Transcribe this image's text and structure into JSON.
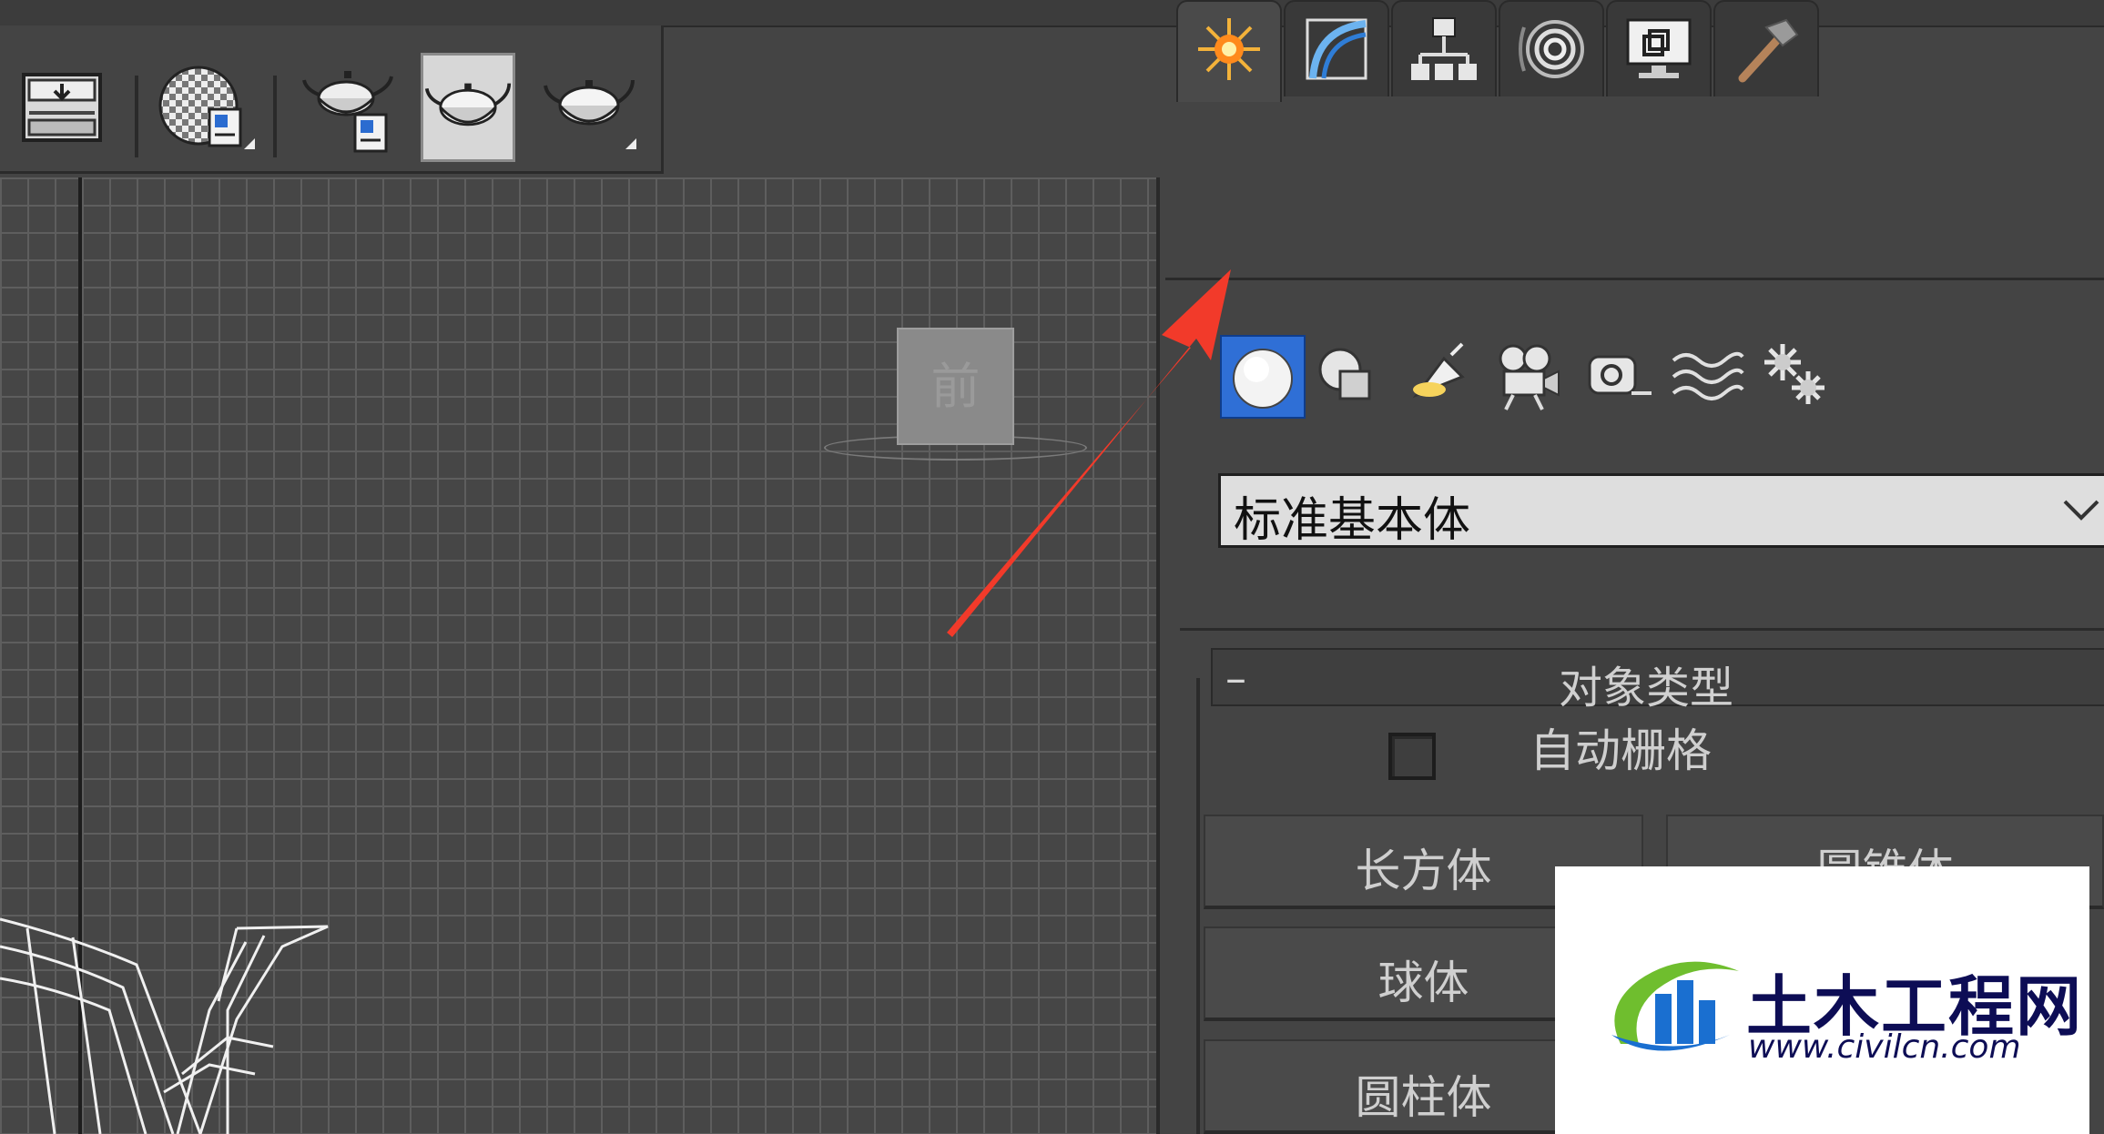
{
  "toolbar": {
    "buttons": [
      {
        "icon": "render-setup-icon"
      },
      {
        "icon": "material-editor-icon"
      },
      {
        "icon": "render-frame-window-icon"
      },
      {
        "icon": "render-production-icon"
      },
      {
        "icon": "render-iterative-icon"
      }
    ]
  },
  "viewport": {
    "viewcube_label": "前"
  },
  "command_panel": {
    "tabs": [
      {
        "icon": "create-tab-icon",
        "active": true
      },
      {
        "icon": "modify-tab-icon",
        "active": false
      },
      {
        "icon": "hierarchy-tab-icon",
        "active": false
      },
      {
        "icon": "motion-tab-icon",
        "active": false
      },
      {
        "icon": "display-tab-icon",
        "active": false
      },
      {
        "icon": "utilities-tab-icon",
        "active": false
      }
    ],
    "create_categories": [
      {
        "icon": "geometry-icon",
        "selected": true
      },
      {
        "icon": "shapes-icon",
        "selected": false
      },
      {
        "icon": "lights-icon",
        "selected": false
      },
      {
        "icon": "cameras-icon",
        "selected": false
      },
      {
        "icon": "helpers-icon",
        "selected": false
      },
      {
        "icon": "space-warps-icon",
        "selected": false
      },
      {
        "icon": "systems-icon",
        "selected": false
      }
    ],
    "primitive_dropdown": "标准基本体",
    "object_type": {
      "collapse_symbol": "–",
      "title": "对象类型",
      "auto_grid_label": "自动栅格",
      "auto_grid_checked": false,
      "buttons": [
        "长方体",
        "圆锥体",
        "球体",
        "圆柱体"
      ]
    }
  },
  "watermark": {
    "name": "土木工程网",
    "url": "www.civilcn.com"
  },
  "annotation": {
    "color": "#f23a2a"
  }
}
